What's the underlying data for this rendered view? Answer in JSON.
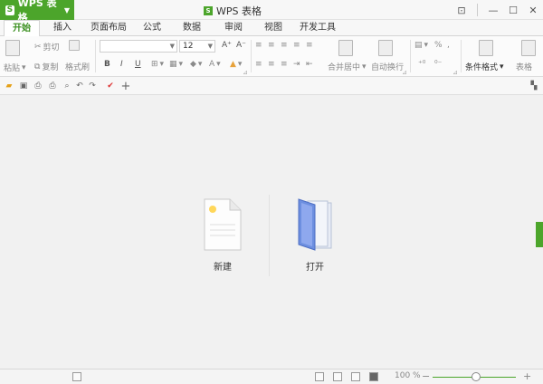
{
  "app": {
    "menu_label": "WPS 表格",
    "logo_letter": "S",
    "window_title": "WPS 表格",
    "accent_color": "#4ca52b"
  },
  "tabs": [
    "开始",
    "插入",
    "页面布局",
    "公式",
    "数据",
    "审阅",
    "视图",
    "开发工具"
  ],
  "ribbon": {
    "paste": "粘贴",
    "cut": "剪切",
    "copy": "复制",
    "format_painter": "格式刷",
    "font_name": "",
    "font_size": "12",
    "grow_font": "A⁺",
    "shrink_font": "A⁻",
    "bold": "B",
    "italic": "I",
    "underline": "U",
    "merge_center": "合并居中",
    "wrap_text": "自动换行",
    "conditional_format": "条件格式",
    "table_style": "表格"
  },
  "start": {
    "new_label": "新建",
    "open_label": "打开"
  },
  "status": {
    "zoom": "100 %"
  }
}
